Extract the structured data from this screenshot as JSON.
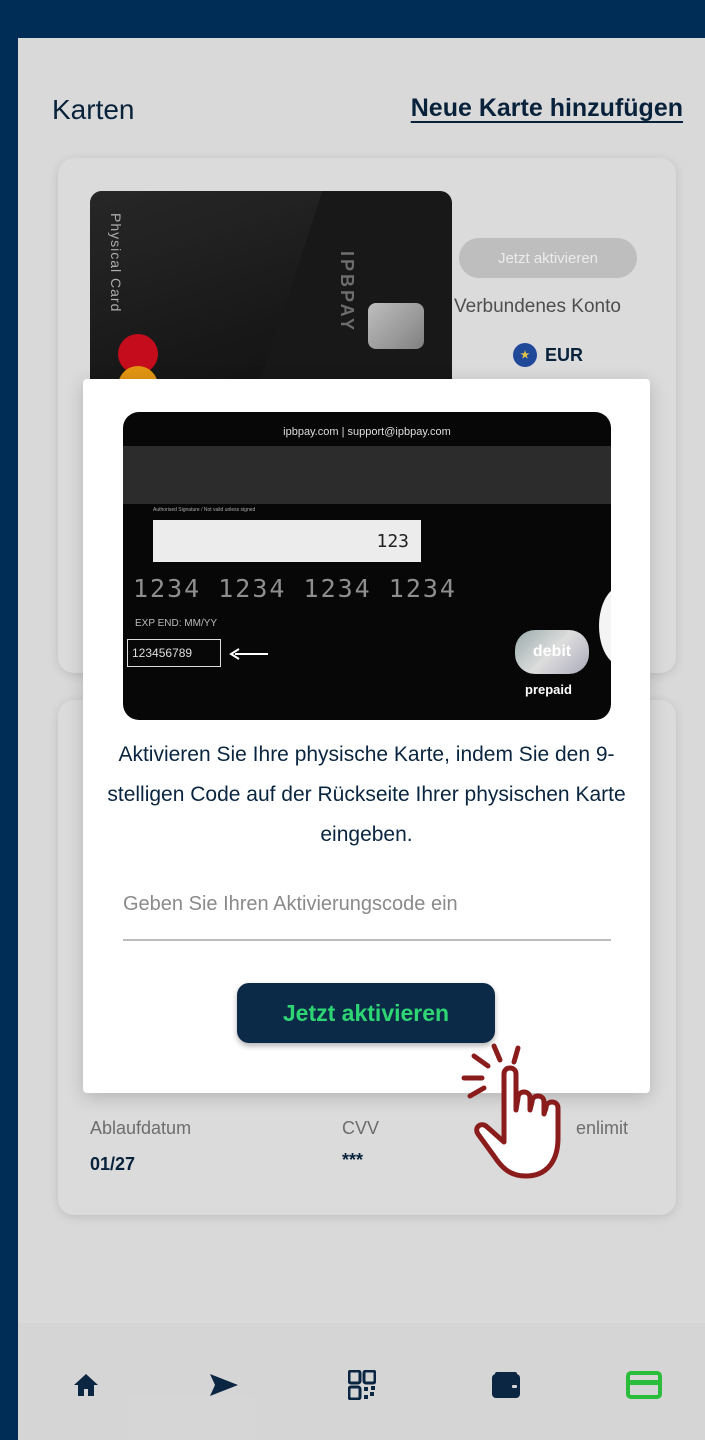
{
  "header": {
    "title": "Karten",
    "add_card_link": "Neue Karte hinzufügen"
  },
  "card1": {
    "side_label": "Physical Card",
    "brand": "IPBPAY",
    "activate_label": "Jetzt aktivieren",
    "connected_account_label": "Verbundenes Konto",
    "currency": "EUR"
  },
  "card2": {
    "expiry_label": "Ablaufdatum",
    "expiry_value": "01/27",
    "cvv_label": "CVV",
    "cvv_value": "***",
    "limit_label_partial": "enlimit"
  },
  "modal": {
    "card_back": {
      "header_text": "ipbpay.com  |  support@ipbpay.com",
      "signature_note": "Authorised Signature / Not valid unless signed",
      "cvv": "123",
      "card_number": "1234 1234 1234 1234",
      "exp_label": "EXP END: MM/YY",
      "activation_code": "123456789",
      "debit_label": "debit",
      "prepaid_label": "prepaid"
    },
    "instruction": "Aktivieren Sie Ihre physische Karte, indem Sie den 9-stelligen Code auf der Rückseite Ihrer physischen Karte eingeben.",
    "input_placeholder": "Geben Sie Ihren Aktivierungscode ein",
    "activate_button": "Jetzt aktivieren"
  },
  "bottom_nav": [
    {
      "icon": "home-icon",
      "active": false
    },
    {
      "icon": "send-icon",
      "active": false
    },
    {
      "icon": "qr-code-icon",
      "active": false
    },
    {
      "icon": "wallet-icon",
      "active": false
    },
    {
      "icon": "card-icon",
      "active": true
    }
  ],
  "colors": {
    "background": "#002d55",
    "primary": "#0b2a48",
    "accent_green": "#2ed573",
    "hand_outline": "#8b1c1c"
  }
}
